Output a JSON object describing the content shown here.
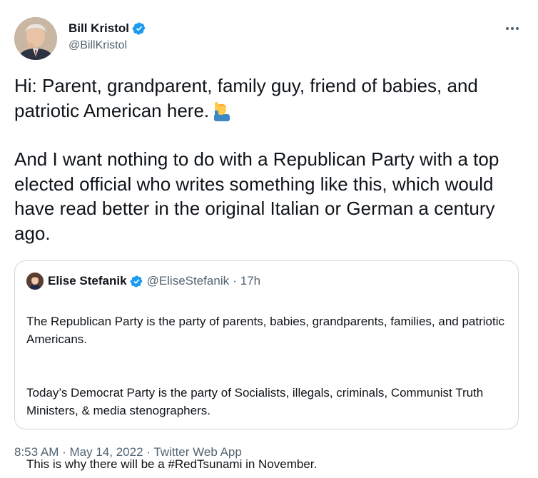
{
  "author": {
    "display_name": "Bill Kristol",
    "handle": "@BillKristol",
    "verified": true,
    "avatar_icon": "profile-photo"
  },
  "more_icon": "ellipsis-icon",
  "tweet": {
    "text": "Hi: Parent, grandparent, family guy, friend of babies, and patriotic American here.",
    "emoji": "person-raising-hand",
    "text2": "And I want nothing to do with a Republican Party with a top elected official who writes something like this, which would have read better in the original Italian or German a century ago."
  },
  "quoted": {
    "display_name": "Elise Stefanik",
    "handle": "@EliseStefanik",
    "separator": "·",
    "time_ago": "17h",
    "verified": true,
    "paragraphs": [
      "The Republican Party is the party of parents, babies, grandparents, families, and patriotic Americans.",
      "Today’s Democrat Party is the party of Socialists, illegals, criminals, Communist Truth Ministers, & media stenographers.",
      "This is why there will be a #RedTsunami in November."
    ]
  },
  "meta": {
    "time": "8:53 AM",
    "sep1": "·",
    "date": "May 14, 2022",
    "sep2": "·",
    "source": "Twitter Web App"
  },
  "colors": {
    "text": "#0f1419",
    "secondary": "#536471",
    "verified": "#1d9bf0",
    "border": "#cfd9de"
  }
}
